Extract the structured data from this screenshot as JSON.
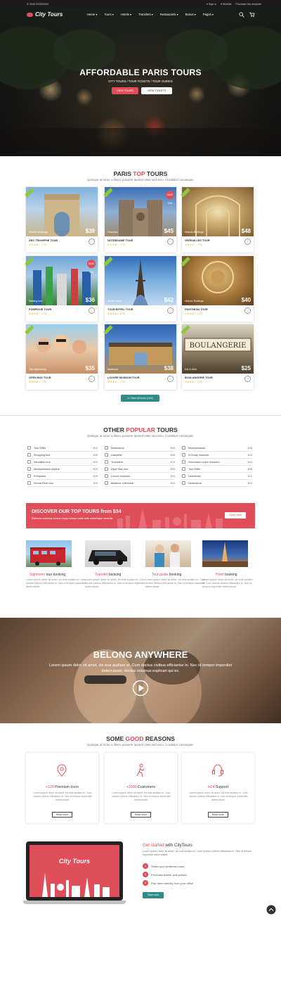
{
  "topbar": {
    "phone": "0045 043204434",
    "signin": "Sign in",
    "wishlist": "Wishlist",
    "purchase": "Purchase this template"
  },
  "logo": {
    "text": "City Tours"
  },
  "menu": [
    "Home ▾",
    "Tours ▾",
    "Hotels ▾",
    "Transfers ▾",
    "Restaurants ▾",
    "Bonus ▾",
    "Pages ▾"
  ],
  "hero": {
    "title": "AFFORDABLE PARIS TOURS",
    "subtitle": "CITY TOURS / TOUR TICKETS / TOUR GUIDES",
    "btn_tours": "VIEW TOURS",
    "btn_tickets": "VIEW TICKETS"
  },
  "top_tours": {
    "title_a": "PARIS ",
    "title_b": "TOP",
    "title_c": " TOURS",
    "subtitle": "Quisque at tortor a libero posuere laoreet vitae sed arcu. Curabitur consequat.",
    "cards": [
      {
        "name": "ARC TRIOMPHE TOUR",
        "category": "Historic Buildings",
        "price": "$39",
        "stars": "★★★★☆ (75)"
      },
      {
        "name": "NOTREDAME TOUR",
        "category": "Churches",
        "price": "$45",
        "stars": "★★★★☆ (75)",
        "badge": "SAVE 30%"
      },
      {
        "name": "VERSAILLES TOUR",
        "category": "Historic Buildings",
        "price": "$48",
        "stars": "★★★★☆ (75)"
      },
      {
        "name": "POMPIDOE TOUR",
        "category": "Walking tour",
        "price": "$36",
        "stars": "★★★★☆ (75)",
        "badge": "SAVE 30%"
      },
      {
        "name": "TOUR EIFFEL TOUR",
        "category": "Skyline tours",
        "price": "$42",
        "stars": "★★★★☆ (75)"
      },
      {
        "name": "PANTHEON TOUR",
        "category": "Historic Buildings",
        "price": "$40",
        "stars": "★★★★☆ (75)"
      },
      {
        "name": "OPEN BUS TOUR",
        "category": "City sightseeing",
        "price": "$35",
        "stars": "★★★★☆ (75)"
      },
      {
        "name": "LOUVRE MUSEUM TOUR",
        "category": "Museums",
        "price": "$38",
        "stars": "★★★★☆ (75)"
      },
      {
        "name": "BOULANGERIE TOUR",
        "category": "Eat & drink",
        "price": "$25",
        "stars": "★★★★☆ (75)"
      }
    ],
    "view_all": "View all tours (144)"
  },
  "popular": {
    "title_a": "OTHER ",
    "title_b": "POPULAR",
    "title_c": " TOURS",
    "subtitle": "Quisque at tortor a libero posuere laoreet vitae sed arcu. Curabitur consequat.",
    "col1": [
      [
        "Tour Eiffel",
        "$42"
      ],
      [
        "Shopping tour",
        "$35"
      ],
      [
        "Versailles tour",
        "$20"
      ],
      [
        "Montparnasse skyline",
        "$26"
      ],
      [
        "Pompidue",
        "$26"
      ],
      [
        "Senna River tour",
        "$26"
      ]
    ],
    "col2": [
      [
        "Notredame",
        "$48"
      ],
      [
        "Lafayette",
        "$56"
      ],
      [
        "Trocadero",
        "$76"
      ],
      [
        "Open Bus tour",
        "$55"
      ],
      [
        "Louvre museum",
        "$24"
      ],
      [
        "Madlene Cathedral",
        "$24"
      ]
    ],
    "col3": [
      [
        "Montparnasse",
        "$36"
      ],
      [
        "D'Orsay museum",
        "$24"
      ],
      [
        "Gioconda Louvre musuem",
        "$44"
      ],
      [
        "Tour Eiffel",
        "$56"
      ],
      [
        "Ladefense",
        "$16"
      ],
      [
        "Notredame",
        "$26"
      ]
    ]
  },
  "banner": {
    "title": "DISCOVER OUR TOP TOURS from $34",
    "subtitle": "Ridiculus sociosqu cursus neque cursus curae ante scelerisque vehicula.",
    "button": "Read more"
  },
  "booking": [
    {
      "a": "Sightseen",
      "b": " tour booking",
      "text": "Lorem ipsum dolor sit amet, vix erat audiam ei. Cum doctus civibus efficiantur in. Nec id tempor imperdiet deterruisset."
    },
    {
      "a": "Transfer",
      "b": " booking",
      "text": "Lorem ipsum dolor sit amet, vix erat audiam ei. Cum doctus civibus efficiantur in. Nec id tempor imperdiet deterruisset."
    },
    {
      "a": "Tour guide",
      "b": " booking",
      "text": "Lorem ipsum dolor sit amet, vix erat audiam ei. Cum doctus civibus efficiantur in. Nec id tempor imperdiet deterruisset."
    },
    {
      "a": "Hotel",
      "b": " booking",
      "text": "Lorem ipsum dolor sit amet, vix erat audiam ei. Cum doctus civibus efficiantur in. Nec id tempor imperdiet deterruisset."
    }
  ],
  "belong": {
    "title": "BELONG ANYWHERE",
    "text": "Lorem ipsum dolor sit amet, vix erat audiam ei. Cum doctus civibus efficiantur in. Nec id tempor imperdiet deterruisset, doctus volumus explicari qui ex."
  },
  "reasons": {
    "title_a": "SOME ",
    "title_b": "GOOD",
    "title_c": " REASONS",
    "subtitle": "Quisque at tortor a libero posuere laoreet vitae sed arcu. Curabitur consequat.",
    "items": [
      {
        "a": "+120",
        "b": " Premium tours",
        "text": "Lorem ipsum dolor sit amet, vix erat audiam ei. Cum doctus civibus efficiantur in. Nec id tempor imperdiet deterruisset.",
        "button": "Read more"
      },
      {
        "a": "+1000",
        "b": " Customers",
        "text": "Lorem ipsum dolor sit amet, vix erat audiam ei. Cum doctus civibus efficiantur in. Nec id tempor imperdiet deterruisset.",
        "button": "Read more"
      },
      {
        "a": "H24",
        "b": " Support",
        "text": "Lorem ipsum dolor sit amet, vix erat audiam ei. Cum doctus civibus efficiantur in. Nec id tempor imperdiet deterruisset.",
        "button": "Read more"
      }
    ]
  },
  "started": {
    "title_a": "Get started",
    "title_b": " with CityTours",
    "text": "Lorem ipsum dolor sit amet, vix erat audiam ei. Cum doctus civibus efficiantur in. Nec id tempor imperdiet deterruisset.",
    "steps": [
      "Select your preferred tours",
      "Purchase tickets and options",
      "Pick them directly from your office"
    ],
    "button": "Start now",
    "screen_logo": "City Tours"
  },
  "colors": {
    "accent": "#e04e5a",
    "green": "#8dc63f",
    "teal": "#2f8c88",
    "dark": "#1b1b1b"
  }
}
